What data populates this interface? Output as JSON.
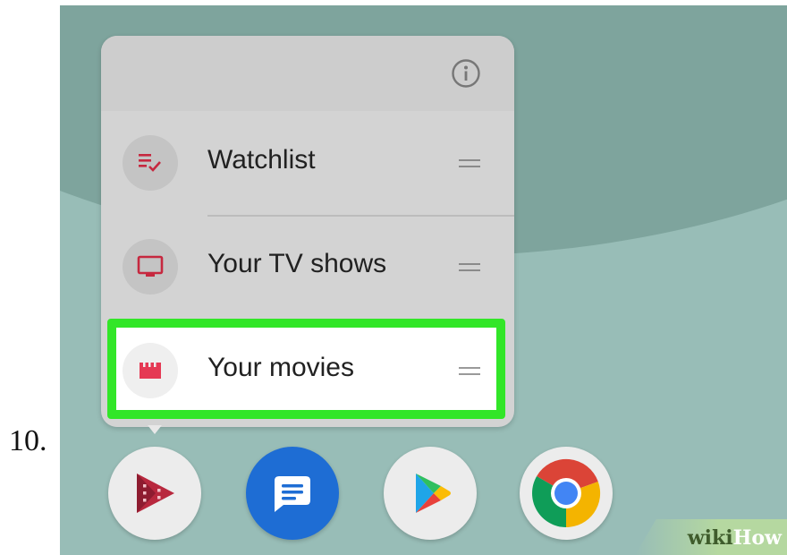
{
  "step": {
    "number": "10."
  },
  "popup": {
    "info_icon": "info-icon",
    "shortcuts": [
      {
        "label": "Watchlist",
        "icon": "watchlist-icon",
        "handle": "drag-handle-icon"
      },
      {
        "label": "Your TV shows",
        "icon": "tv-icon",
        "handle": "drag-handle-icon"
      },
      {
        "label": "Your movies",
        "icon": "clapperboard-icon",
        "handle": "drag-handle-icon",
        "highlighted": true
      }
    ]
  },
  "dock": {
    "apps": [
      {
        "name": "Google Play Movies & TV",
        "icon": "play-movies-icon"
      },
      {
        "name": "Messages",
        "icon": "messages-icon"
      },
      {
        "name": "Google Play Store",
        "icon": "play-store-icon"
      },
      {
        "name": "Chrome",
        "icon": "chrome-icon"
      }
    ]
  },
  "watermark": {
    "part1": "wiki",
    "part2": "How"
  },
  "colors": {
    "wallpaper_light": "#98bdb7",
    "wallpaper_dark": "#7ea49d",
    "popup_bg": "#d3d3d3",
    "highlight": "#32e628",
    "accent_red": "#e53954",
    "icon_red": "#c6283f"
  }
}
